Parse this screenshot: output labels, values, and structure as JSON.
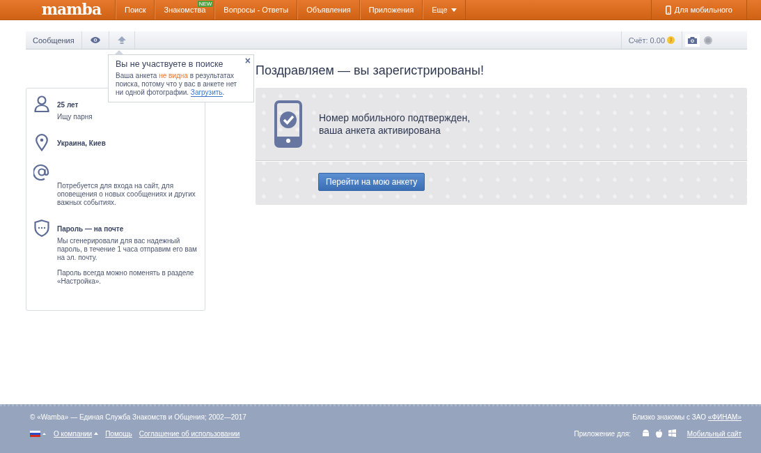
{
  "header": {
    "logo": "mamba",
    "nav": [
      {
        "label": "Поиск"
      },
      {
        "label": "Знакомства",
        "badge": "NEW"
      },
      {
        "label": "Вопросы - Ответы"
      },
      {
        "label": "Объявления"
      },
      {
        "label": "Приложения"
      },
      {
        "label": "Еще",
        "dropdown": true
      }
    ],
    "mobile": "Для мобильного"
  },
  "toolbar": {
    "messages": "Сообщения",
    "balance": "Счёт: 0.00"
  },
  "tooltip": {
    "title": "Вы не участвуете в поиске",
    "text_before": "Ваша анкета ",
    "highlight": "не видна",
    "text_after": " в результатах поиска, потому что у вас в анкете нет ни одной фотографии. ",
    "link": "Загрузить",
    "end": ".",
    "close": "×"
  },
  "profile": {
    "age": "25 лет",
    "seeking": "Ищу парня",
    "location": "Украина, Киев",
    "email_note": "Потребуется для входа на сайт, для оповещения о новых сообщениях и других важных событиях.",
    "password_title": "Пароль — на почте",
    "password_text": "Мы сгенерировали для вас надежный пароль, в течение 1 часа отправим его вам на эл. почту.",
    "password_note": "Пароль всегда можно поменять в разделе «Настройка»."
  },
  "main": {
    "title": "Поздравляем — вы зарегистрированы!",
    "notice": [
      "Номер мобильного подтвержден,",
      "ваша анкета активирована"
    ],
    "button": "Перейти на мою анкету"
  },
  "footer": {
    "copyright": "© «Wamba» — Единая Служба Знакомств и Общения; 2002—2017",
    "partner_text": "Близко знакомы с ЗАО ",
    "partner_link": "«ФИНАМ»",
    "links": [
      {
        "label": "О компании",
        "caret": true
      },
      {
        "label": "Помощь",
        "caret": false
      },
      {
        "label": "Соглашение об использовании",
        "caret": false
      }
    ],
    "app_label": "Приложение для:",
    "mobile_site": "Мобильный сайт"
  }
}
